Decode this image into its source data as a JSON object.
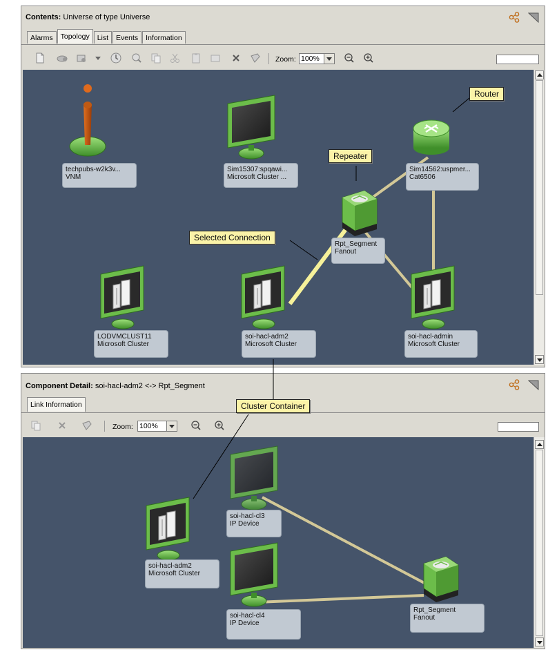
{
  "top_panel": {
    "title_prefix": "Contents:",
    "title": "Universe of type Universe",
    "tabs": [
      "Alarms",
      "Topology",
      "List",
      "Events",
      "Information"
    ],
    "active_tab": "Topology",
    "zoom_label": "Zoom:",
    "zoom_value": "100%",
    "nodes": [
      {
        "name": "techpubs-w2k3v...",
        "type": "VNM",
        "icon": "vnm-pin-icon"
      },
      {
        "name": "Sim15307:spqawi...",
        "type": "Microsoft Cluster ...",
        "icon": "monitor-icon"
      },
      {
        "name": "Sim14562:uspmer...",
        "type": "Cat6506",
        "icon": "router-icon"
      },
      {
        "name": "Rpt_Segment",
        "type": "Fanout",
        "icon": "repeater-icon"
      },
      {
        "name": "LODVMCLUST11",
        "type": "Microsoft Cluster",
        "icon": "cluster-icon"
      },
      {
        "name": "soi-hacl-adm2",
        "type": "Microsoft Cluster",
        "icon": "cluster-icon"
      },
      {
        "name": "soi-hacl-admin",
        "type": "Microsoft Cluster",
        "icon": "cluster-icon"
      }
    ]
  },
  "bottom_panel": {
    "title_prefix": "Component Detail:",
    "title": "soi-hacl-adm2 <-> Rpt_Segment",
    "tabs": [
      "Link Information"
    ],
    "active_tab": "Link Information",
    "zoom_label": "Zoom:",
    "zoom_value": "100%",
    "nodes": [
      {
        "name": "soi-hacl-cl3",
        "type": "IP Device",
        "icon": "monitor-icon"
      },
      {
        "name": "soi-hacl-adm2",
        "type": "Microsoft Cluster",
        "icon": "cluster-icon"
      },
      {
        "name": "soi-hacl-cl4",
        "type": "IP Device",
        "icon": "monitor-icon"
      },
      {
        "name": "Rpt_Segment",
        "type": "Fanout",
        "icon": "repeater-icon"
      }
    ]
  },
  "callouts": {
    "router": "Router",
    "repeater": "Repeater",
    "selected_connection": "Selected Connection",
    "cluster_container": "Cluster Container"
  },
  "colors": {
    "canvas": "#45546a",
    "panel": "#dcdad2",
    "link": "#e8d8a0",
    "selected_link": "#f8f090",
    "device_green": "#6cbd4a",
    "callout_bg": "#fbf3a8"
  }
}
